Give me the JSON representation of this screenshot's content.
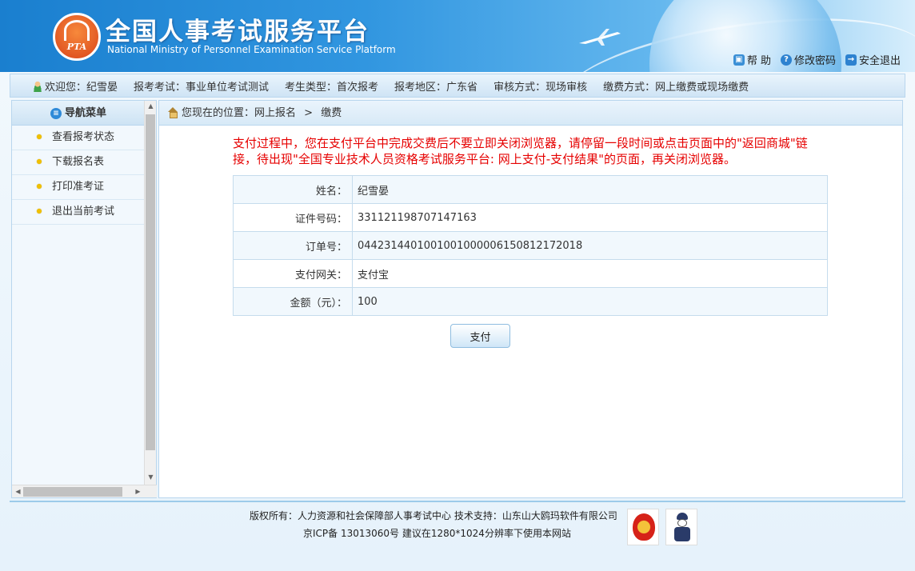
{
  "header": {
    "logo_text": "PTA",
    "title": "全国人事考试服务平台",
    "subtitle": "National Ministry of Personnel Examination Service Platform",
    "links": [
      {
        "label": "帮 助",
        "icon": "lock-icon"
      },
      {
        "label": "修改密码",
        "icon": "question-icon"
      },
      {
        "label": "安全退出",
        "icon": "logout-icon"
      }
    ]
  },
  "infobar": {
    "welcome": "欢迎您：纪雪晏",
    "exam": "报考考试：事业单位考试测试",
    "candidate_type": "考生类型：首次报考",
    "region": "报考地区：广东省",
    "review": "审核方式：现场审核",
    "payment": "缴费方式：网上缴费或现场缴费"
  },
  "sidebar": {
    "title": "导航菜单",
    "items": [
      "查看报考状态",
      "下载报名表",
      "打印准考证",
      "退出当前考试"
    ]
  },
  "breadcrumb": {
    "prefix": "您现在的位置：网上报名",
    "separator": ">",
    "current": "缴费"
  },
  "notice": "支付过程中，您在支付平台中完成交费后不要立即关闭浏览器，请停留一段时间或点击页面中的\"返回商城\"链接，待出现\"全国专业技术人员资格考试服务平台: 网上支付-支付结果\"的页面，再关闭浏览器。",
  "payment_info": [
    {
      "label": "姓名：",
      "value": "纪雪晏"
    },
    {
      "label": "证件号码：",
      "value": "331121198707147163"
    },
    {
      "label": "订单号：",
      "value": "044231440100100100000615081217201 8"
    },
    {
      "label": "支付网关：",
      "value": "支付宝"
    },
    {
      "label": "金额（元）：",
      "value": "100"
    }
  ],
  "pay_button": "支付",
  "footer": {
    "line1": "版权所有：人力资源和社会保障部人事考试中心  技术支持：山东山大鸥玛软件有限公司",
    "line2": "京ICP备 13013060号  建议在1280*1024分辨率下使用本网站"
  },
  "colors": {
    "notice": "#e60000",
    "header_blue": "#1a7fcf",
    "menu_dot": "#f0c000"
  }
}
